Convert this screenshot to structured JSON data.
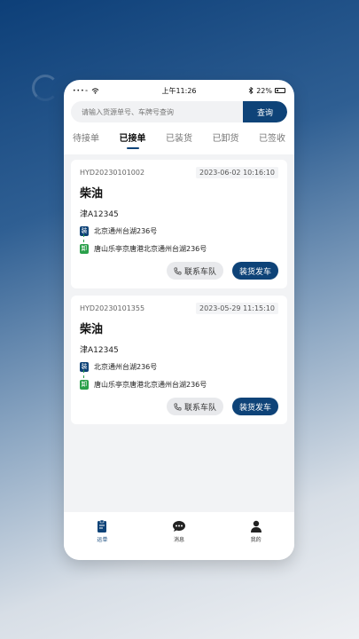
{
  "status_bar": {
    "signal": "•••∘",
    "time": "上午11:26",
    "battery": "22%"
  },
  "search": {
    "placeholder": "请输入货源单号、车牌号查询",
    "button_label": "查询"
  },
  "tabs": [
    {
      "label": "待接单",
      "active": false
    },
    {
      "label": "已接单",
      "active": true
    },
    {
      "label": "已装货",
      "active": false
    },
    {
      "label": "已卸货",
      "active": false
    },
    {
      "label": "已签收",
      "active": false
    }
  ],
  "orders": [
    {
      "order_no": "HYD20230101002",
      "time": "2023-06-02 10:16:10",
      "cargo": "柴油",
      "plate": "津A12345",
      "load_tag": "装",
      "load_addr": "北京通州台湖236号",
      "unload_tag": "卸",
      "unload_addr": "唐山乐亭京唐港北京通州台湖236号",
      "contact_label": "联系车队",
      "ship_label": "装货发车"
    },
    {
      "order_no": "HYD20230101355",
      "time": "2023-05-29 11:15:10",
      "cargo": "柴油",
      "plate": "津A12345",
      "load_tag": "装",
      "load_addr": "北京通州台湖236号",
      "unload_tag": "卸",
      "unload_addr": "唐山乐亭京唐港北京通州台湖236号",
      "contact_label": "联系车队",
      "ship_label": "装货发车"
    }
  ],
  "tabbar": [
    {
      "label": "运单",
      "icon": "waybill-icon",
      "active": true
    },
    {
      "label": "消息",
      "icon": "message-icon",
      "active": false
    },
    {
      "label": "我的",
      "icon": "profile-icon",
      "active": false
    }
  ],
  "colors": {
    "primary": "#0e4378",
    "unload_green": "#2aa04a"
  }
}
